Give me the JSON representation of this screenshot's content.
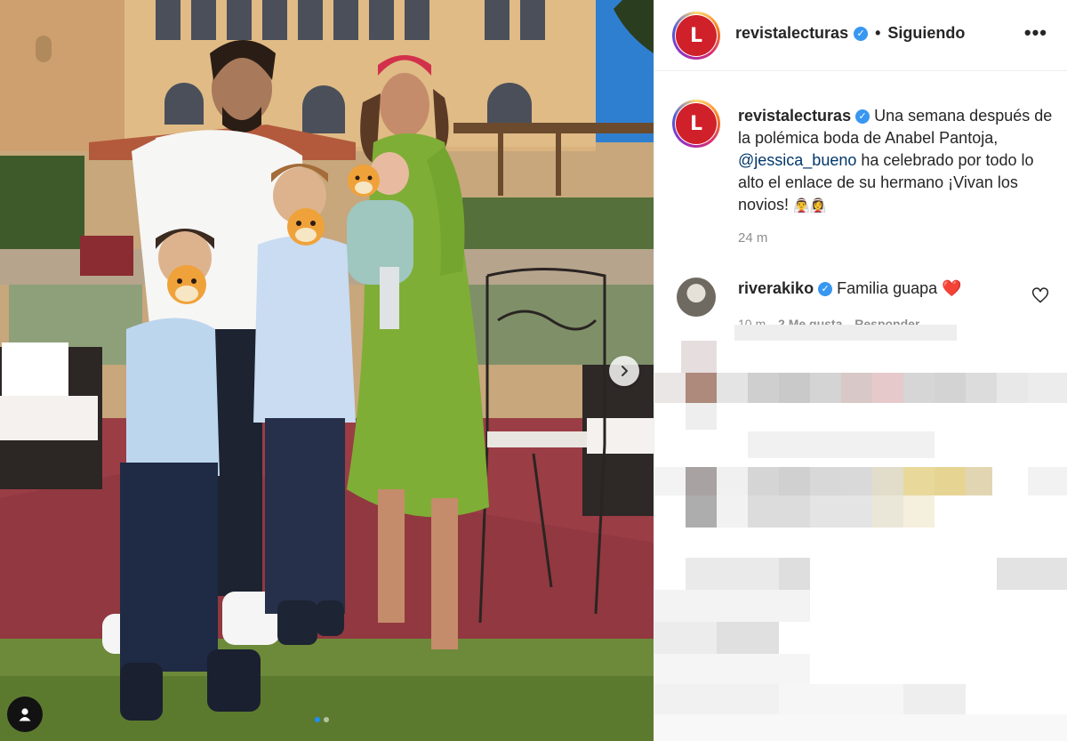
{
  "header": {
    "username": "revistalecturas",
    "verified": true,
    "follow_status": "Siguiendo",
    "more_icon": "more-horizontal-icon"
  },
  "caption": {
    "username": "revistalecturas",
    "text_before": "Una semana después de la polémica boda de Anabel Pantoja,",
    "mention": "@jessica_bueno",
    "text_after": "ha celebrado por todo lo alto el enlace de su hermano ¡Vivan los novios!",
    "emoji_tail": "👰‍♂️👰‍♀️",
    "time_ago": "24 m"
  },
  "comment": {
    "username": "riverakiko",
    "verified": true,
    "text": "Familia guapa",
    "emoji": "❤️",
    "meta_time": "10 m",
    "meta_likes": "2 Me gusta",
    "meta_reply": "Responder"
  },
  "photo": {
    "carousel_count": 2,
    "carousel_active": 1
  },
  "colors": {
    "accent_blue": "#3897f0",
    "mention_blue": "#00376b",
    "brand_red": "#d0202a",
    "meta_grey": "#8e8e8e"
  }
}
